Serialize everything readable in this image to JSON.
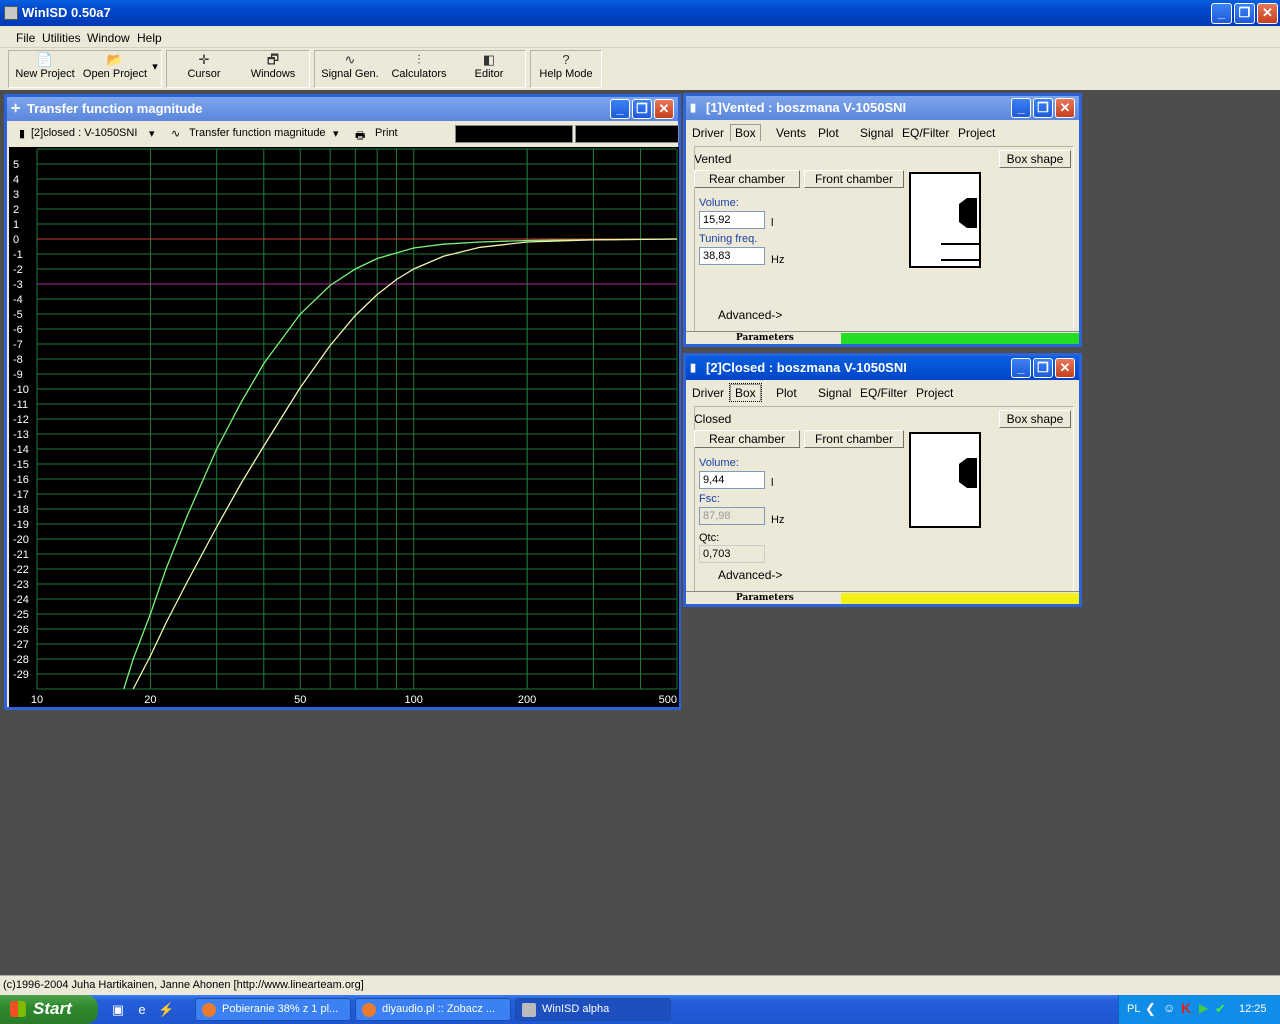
{
  "app": {
    "title": "WinISD 0.50a7",
    "window_buttons": {
      "minimize": "_",
      "restore": "❐",
      "close": "✕"
    }
  },
  "menu": [
    "File",
    "Utilities",
    "Window",
    "Help"
  ],
  "toolbar": [
    {
      "label": "New Project",
      "icon": "📄"
    },
    {
      "label": "Open Project",
      "icon": "📂"
    },
    {
      "label": "Cursor",
      "icon": "✛"
    },
    {
      "label": "Windows",
      "icon": "🗗"
    },
    {
      "label": "Signal Gen.",
      "icon": "∿"
    },
    {
      "label": "Calculators",
      "icon": "⫶"
    },
    {
      "label": "Editor",
      "icon": "◧"
    },
    {
      "label": "Help Mode",
      "icon": "?"
    }
  ],
  "graph_window": {
    "title": "Transfer function magnitude",
    "project_select": "[2]closed : V-1050SNI",
    "plot_select": "Transfer function magnitude",
    "print_label": "Print"
  },
  "chart_data": {
    "type": "line",
    "title": "",
    "xlabel": "",
    "ylabel": "",
    "x_scale": "log",
    "xlim": [
      10,
      500
    ],
    "ylim": [
      -30,
      6
    ],
    "x_tick_labels": [
      "10",
      "20",
      "50",
      "100",
      "200",
      "500"
    ],
    "y_tick_labels": [
      "5",
      "4",
      "3",
      "2",
      "1",
      "0",
      "-1",
      "-2",
      "-3",
      "-4",
      "-5",
      "-6",
      "-7",
      "-8",
      "-9",
      "-10",
      "-11",
      "-12",
      "-13",
      "-14",
      "-15",
      "-16",
      "-17",
      "-18",
      "-19",
      "-20",
      "-21",
      "-22",
      "-23",
      "-24",
      "-25",
      "-26",
      "-27",
      "-28",
      "-29"
    ],
    "reference_lines": [
      {
        "y": 0,
        "color": "#d23a3a"
      },
      {
        "y": -3,
        "color": "#b0289a"
      }
    ],
    "grid": true,
    "series": [
      {
        "color": "#7df07a",
        "x": [
          17,
          18,
          20,
          22,
          25,
          30,
          35,
          40,
          50,
          60,
          70,
          80,
          100,
          120,
          150,
          200,
          300,
          500
        ],
        "y": [
          -30,
          -28,
          -25,
          -22,
          -18.5,
          -14,
          -10.8,
          -8.3,
          -5,
          -3.1,
          -2,
          -1.3,
          -0.6,
          -0.35,
          -0.2,
          -0.1,
          -0.05,
          0
        ]
      },
      {
        "color": "#f2f2b0",
        "x": [
          18,
          20,
          22,
          25,
          30,
          35,
          40,
          50,
          60,
          70,
          80,
          90,
          100,
          120,
          150,
          200,
          300,
          500
        ],
        "y": [
          -30,
          -27.8,
          -25.6,
          -22.9,
          -19.2,
          -16.2,
          -13.8,
          -9.9,
          -7.1,
          -5.1,
          -3.7,
          -2.7,
          -2,
          -1.15,
          -0.55,
          -0.2,
          -0.06,
          0
        ]
      }
    ]
  },
  "vented_window": {
    "title": "[1]Vented : boszmana  V-1050SNI",
    "tabs": [
      "Driver",
      "Box",
      "Vents",
      "Plot",
      "Signal",
      "EQ/Filter",
      "Project"
    ],
    "active_tab": "Box",
    "box_type": "Vented",
    "box_shape_button": "Box shape",
    "rear_chamber": "Rear chamber",
    "front_chamber": "Front chamber",
    "volume_label": "Volume:",
    "volume_value": "15,92",
    "volume_unit": "l",
    "tuning_label": "Tuning freq.",
    "tuning_value": "38,83",
    "tuning_unit": "Hz",
    "advanced": "Advanced->",
    "parameters_label": "Parameters",
    "status_color": "#22dd22"
  },
  "closed_window": {
    "title": "[2]Closed : boszmana  V-1050SNI",
    "tabs": [
      "Driver",
      "Box",
      "Plot",
      "Signal",
      "EQ/Filter",
      "Project"
    ],
    "active_tab": "Box",
    "box_type": "Closed",
    "box_shape_button": "Box shape",
    "rear_chamber": "Rear chamber",
    "front_chamber": "Front chamber",
    "volume_label": "Volume:",
    "volume_value": "9,44",
    "volume_unit": "l",
    "fsc_label": "Fsc:",
    "fsc_value": "87,98",
    "fsc_unit": "Hz",
    "qtc_label": "Qtc:",
    "qtc_value": "0,703",
    "advanced": "Advanced->",
    "parameters_label": "Parameters",
    "status_color": "#f2f21a"
  },
  "status_text": "(c)1996-2004 Juha Hartikainen, Janne Ahonen [http://www.linearteam.org]",
  "taskbar": {
    "start": "Start",
    "tasks": [
      "Pobieranie 38% z 1 pl...",
      "diyaudio.pl :: Zobacz ...",
      "WinISD alpha"
    ],
    "tray_lang": "PL",
    "clock": "12:25"
  }
}
